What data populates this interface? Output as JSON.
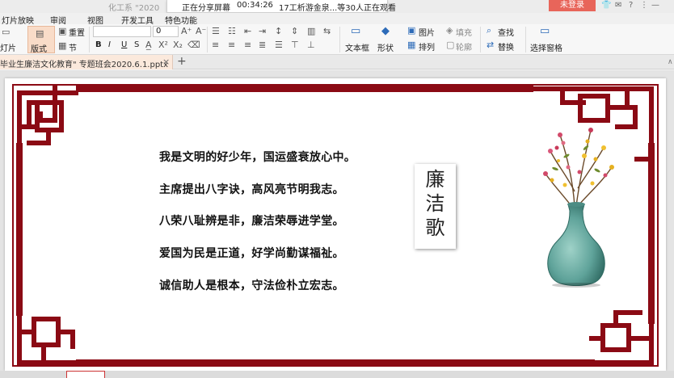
{
  "window": {
    "title": "化工系 \"2020",
    "share_status": "正在分享屏幕",
    "share_time": "00:34:26",
    "share_viewers": "17工析游金泉...等30人正在观看",
    "login_label": "未登录",
    "icons": [
      "shirt-icon",
      "chat-icon",
      "help-icon",
      "more-icon",
      "minimize-icon"
    ]
  },
  "menu": {
    "tabs": [
      "灯片放映",
      "审阅",
      "视图",
      "开发工具",
      "特色功能"
    ]
  },
  "ribbon": {
    "slide_label": "灯片",
    "reset_label": "重置",
    "layout_label": "版式",
    "section_label": "节",
    "font_size": "0",
    "bold": "B",
    "italic": "I",
    "underline": "U",
    "strike": "S",
    "textbox_label": "文本框",
    "shape_label": "形状",
    "picture_label": "图片",
    "arrange_label": "排列",
    "fill_label": "填充",
    "outline_label": "轮廓",
    "find_label": "查找",
    "replace_label": "替换",
    "select_pane_label": "选择窗格"
  },
  "doc_tab": {
    "name": "毕业生廉洁文化教育\" 专题班会2020.6.1.pptx",
    "close": "×",
    "new": "+"
  },
  "slide": {
    "poem": [
      "我是文明的好少年，国运盛衰放心中。",
      "主席提出八字诀，高风亮节明我志。",
      "八荣八耻辨是非，廉洁荣辱进学堂。",
      "爱国为民是正道，好学尚勤谋福祉。",
      "诚信助人是根本，守法俭朴立宏志。"
    ],
    "title_chars": [
      "廉",
      "洁",
      "歌"
    ],
    "frame_color": "#8b0a14",
    "vase_color": "#5fa39a"
  },
  "scroll_indicator": "∧"
}
